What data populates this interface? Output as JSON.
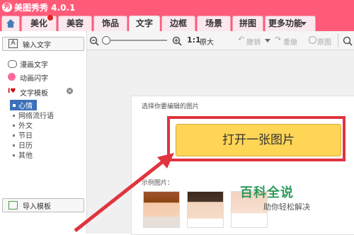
{
  "window": {
    "title": "美图秀秀 4.0.1"
  },
  "tabs": [
    {
      "label": "美化"
    },
    {
      "label": "美容"
    },
    {
      "label": "饰品"
    },
    {
      "label": "文字"
    },
    {
      "label": "边框"
    },
    {
      "label": "场景"
    },
    {
      "label": "拼图"
    },
    {
      "label": "更多功能"
    }
  ],
  "toolbar": {
    "zoom_ratio": "1:1",
    "original_size": "原大",
    "undo": "撤销",
    "redo": "重做",
    "original_image": "原图"
  },
  "sidebar": {
    "input_text": "输入文字",
    "comic_text": "漫画文字",
    "animated_text": "动画闪字",
    "text_template": "文字模板",
    "template_items": [
      "心情",
      "网络流行语",
      "外文",
      "节日",
      "日历",
      "其他"
    ],
    "import_template": "导入模板"
  },
  "main": {
    "prompt": "选择你要编辑的图片",
    "open_button": "打开一张图片",
    "sample_label": "示例图片："
  },
  "watermark": {
    "title": "百科全说",
    "subtitle": "助你轻松解决"
  },
  "colors": {
    "title_bar": "#ff5b79",
    "open_button": "#ffd556",
    "highlight": "#e0343f",
    "selected_item": "#3b71b8"
  }
}
